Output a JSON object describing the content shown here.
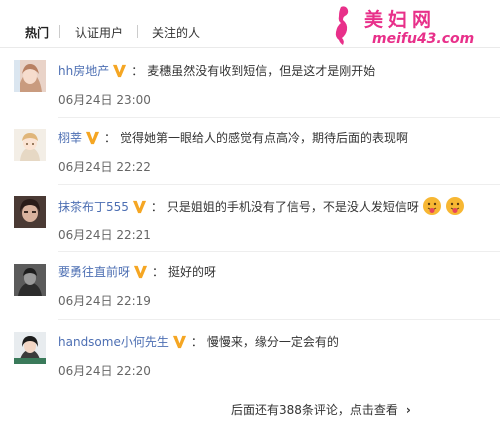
{
  "tabs": [
    {
      "label": "热门",
      "active": true
    },
    {
      "label": "认证用户",
      "active": false
    },
    {
      "label": "关注的人",
      "active": false
    }
  ],
  "watermark": {
    "title": "美妇网",
    "url": "meifu43.com",
    "color": "#e8308a"
  },
  "colors": {
    "username": "#4d6fb3",
    "badge": "#f5a623",
    "text": "#333333",
    "time": "#666666"
  },
  "comments": [
    {
      "username": "hh房地产",
      "badge": "v-badge-icon",
      "text": "麦穗虽然没有收到短信，但是这才是刚开始",
      "time": "06月24日 23:00",
      "emojis": 0
    },
    {
      "username": "栩莘",
      "badge": "v-badge-icon",
      "text": "觉得她第一眼给人的感觉有点高冷，期待后面的表现啊",
      "time": "06月24日 22:22",
      "emojis": 0
    },
    {
      "username": "抹茶布丁555",
      "badge": "v-badge-icon",
      "text": "只是姐姐的手机没有了信号，不是没人发短信呀",
      "time": "06月24日 22:21",
      "emojis": 2
    },
    {
      "username": "要勇往直前呀",
      "badge": "v-badge-icon",
      "text": "挺好的呀",
      "time": "06月24日 22:19",
      "emojis": 0
    },
    {
      "username": "handsome小何先生",
      "badge": "v-badge-icon",
      "text": "慢慢来，缘分一定会有的",
      "time": "06月24日 22:20",
      "emojis": 0
    }
  ],
  "more_link": {
    "label": "后面还有388条评论，点击查看",
    "arrow": "›"
  }
}
